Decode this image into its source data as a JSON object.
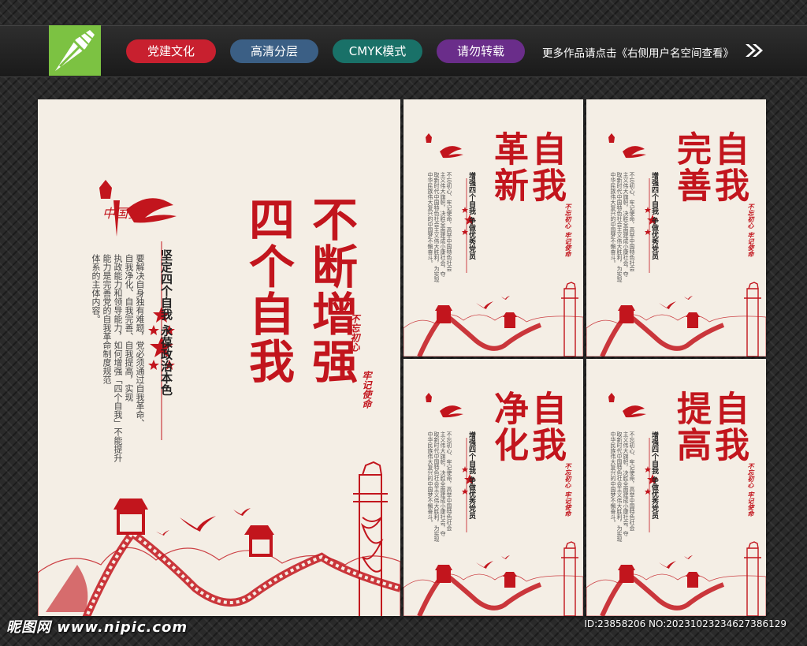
{
  "toolbar": {
    "tags": [
      {
        "label": "党建文化",
        "color": "#c8202f"
      },
      {
        "label": "高清分层",
        "color": "#3b5f85"
      },
      {
        "label": "CMYK模式",
        "color": "#197168"
      },
      {
        "label": "请勿转载",
        "color": "#6a2d8a"
      }
    ],
    "promo_text": "更多作品请点击《右侧用户名空间查看》",
    "promo_icon": "double-chevron-right-icon",
    "logo_icon": "pen-nib-logo-icon"
  },
  "colors": {
    "accent_red": "#c2151d",
    "poster_bg": "#f4eee5",
    "logo_green": "#7cc242"
  },
  "main_poster": {
    "title": "不断增强\n四个自我",
    "heading": "坚定四个自我  永葆政治本色",
    "body": "要解决自身独有难题，党必须通过自我革命、\n自我净化、自我完善、自我提高，实现\n执政能力和领导能力，如何增强「四个自我」不能提升\n能力是完善党的自我革命制度规范\n体系的主体内容。",
    "slogan_1": "不忘初心",
    "slogan_2": "牢记使命"
  },
  "small_posters": [
    {
      "title": "自我\n革新",
      "heading": "增强四个自我  争做优秀党员",
      "body": "不忘初心、牢记使命，高举中国特色社会\n主义伟大旗帜，决胜全面建成小康社会，夺\n取新时代中国特色社会主义伟大胜利，为实现\n中华民族伟大复兴的中国梦不懈奋斗。",
      "slogan_1": "不忘初心",
      "slogan_2": "牢记使命"
    },
    {
      "title": "自我\n完善",
      "heading": "增强四个自我  争做优秀党员",
      "body": "不忘初心、牢记使命，高举中国特色社会\n主义伟大旗帜，决胜全面建成小康社会，夺\n取新时代中国特色社会主义伟大胜利，为实现\n中华民族伟大复兴的中国梦不懈奋斗。",
      "slogan_1": "不忘初心",
      "slogan_2": "牢记使命"
    },
    {
      "title": "自我\n净化",
      "heading": "增强四个自我  争做优秀党员",
      "body": "不忘初心、牢记使命，高举中国特色社会\n主义伟大旗帜，决胜全面建成小康社会，夺\n取新时代中国特色社会主义伟大胜利，为实现\n中华民族伟大复兴的中国梦不懈奋斗。",
      "slogan_1": "不忘初心",
      "slogan_2": "牢记使命"
    },
    {
      "title": "自我\n提高",
      "heading": "增强四个自我  争做优秀党员",
      "body": "不忘初心、牢记使命，高举中国特色社会\n主义伟大旗帜，决胜全面建成小康社会，夺\n取新时代中国特色社会主义伟大胜利，为实现\n中华民族伟大复兴的中国梦不懈奋斗。",
      "slogan_1": "不忘初心",
      "slogan_2": "牢记使命"
    }
  ],
  "emblem": {
    "text": "中国梦"
  },
  "watermark": {
    "left": "昵图网  www.nipic.com",
    "right": "ID:23858206 NO:20231023234627386129"
  }
}
